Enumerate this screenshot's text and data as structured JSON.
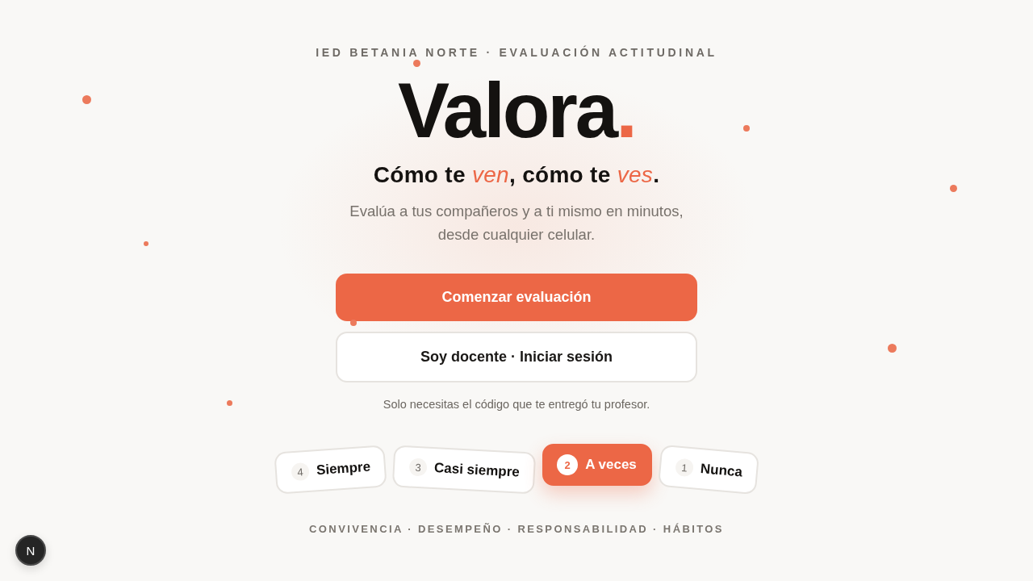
{
  "header": {
    "eyebrow": "IED BETANIA NORTE · EVALUACIÓN ACTITUDINAL"
  },
  "brand": {
    "name": "Valora",
    "accent": "."
  },
  "tagline": "Cómo te *ven*, cómo te *ves*.",
  "description": "Evalúa a tus compañeros y a ti mismo en minutos, desde cualquier celular.",
  "actions": [
    {
      "kind": "primary",
      "label": "Comenzar evaluación"
    },
    {
      "kind": "secondary",
      "label": "Soy docente · Iniciar sesión"
    }
  ],
  "helper_text": "Solo necesitas el código que te entregó tu profesor.",
  "scale": [
    {
      "number": "4",
      "label": "Siempre",
      "selected": false
    },
    {
      "number": "3",
      "label": "Casi siempre",
      "selected": false
    },
    {
      "number": "2",
      "label": "A veces",
      "selected": true
    },
    {
      "number": "1",
      "label": "Nunca",
      "selected": false
    }
  ],
  "categories": "CONVIVENCIA · DESEMPEÑO · RESPONSABILIDAD · HÁBITOS",
  "dev_badge": {
    "label": "N"
  }
}
